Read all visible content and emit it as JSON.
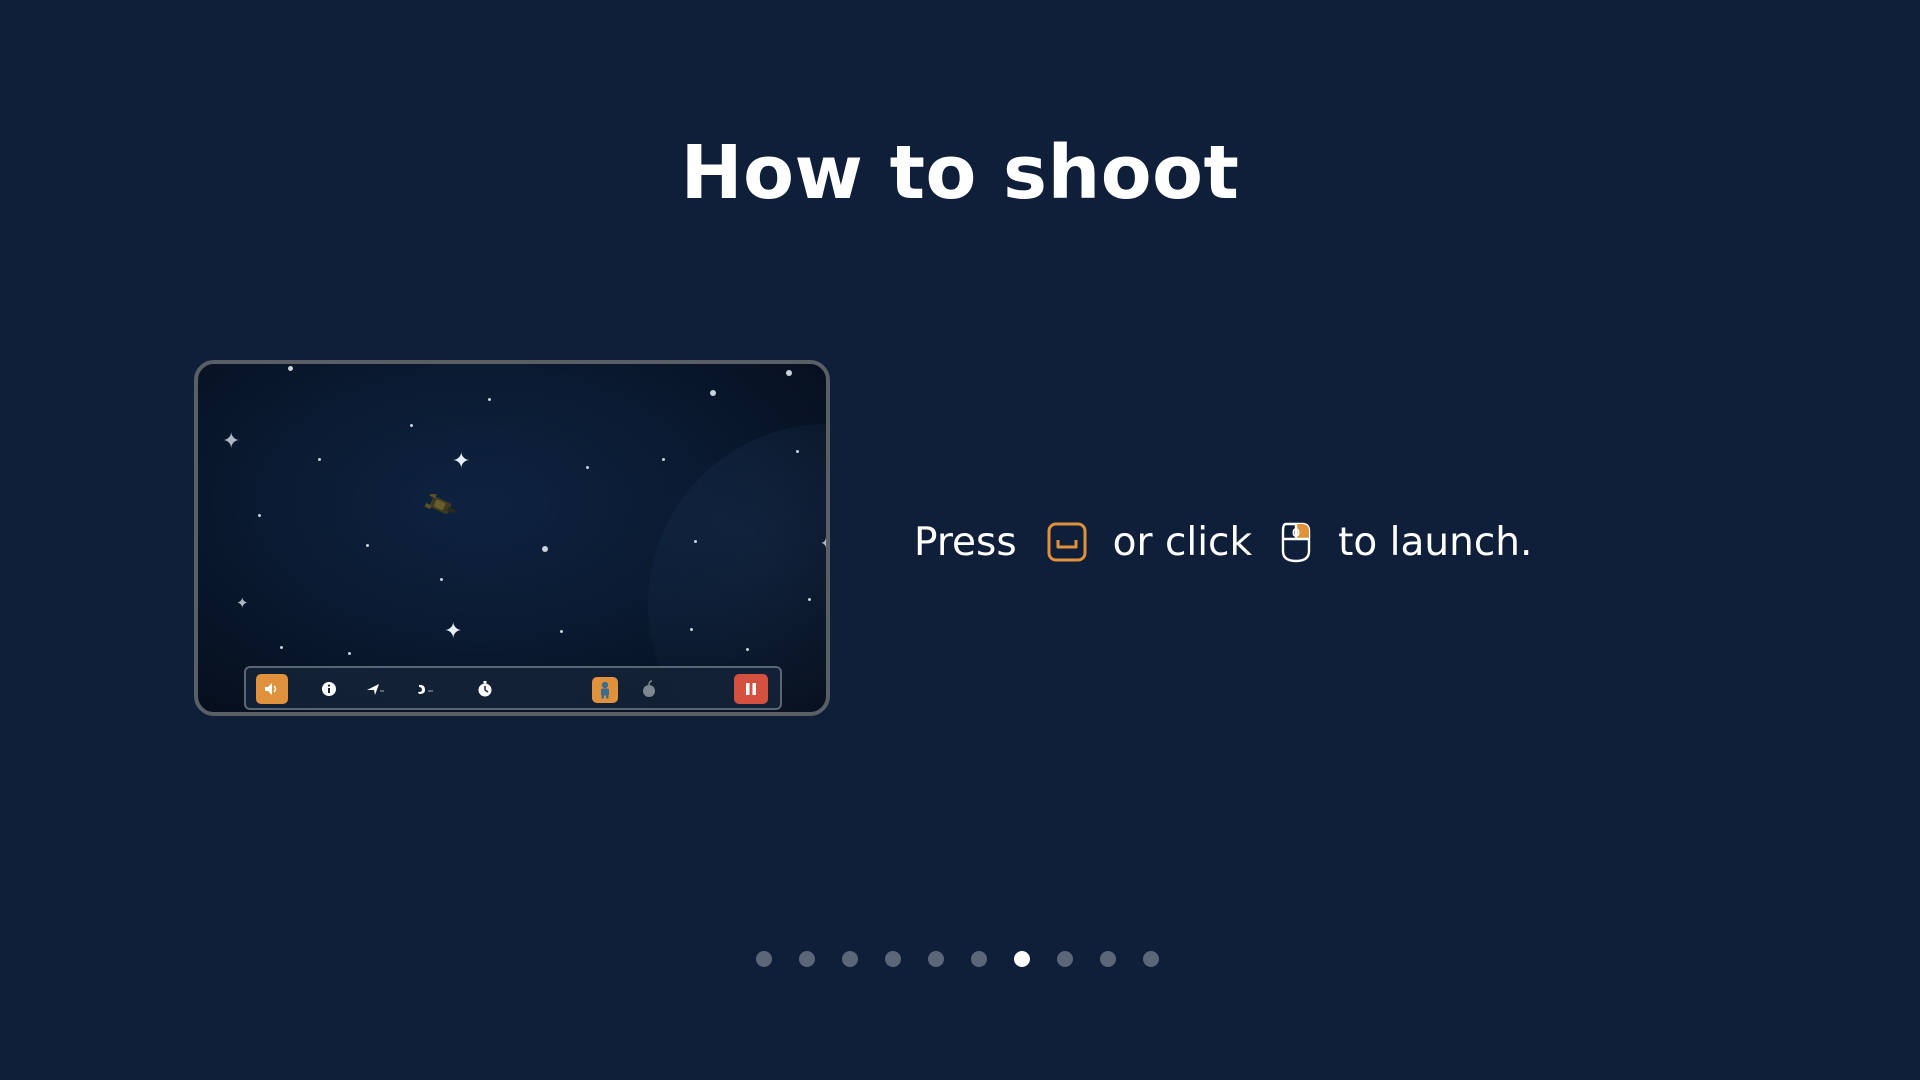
{
  "title": "How to shoot",
  "instruction": {
    "press": "Press",
    "or_click": "or click",
    "to_launch": "to launch.",
    "key_icon": "spacebar-key-icon",
    "mouse_icon": "mouse-left-click-icon"
  },
  "preview": {
    "hud_icons": [
      "sound-icon",
      "info-icon",
      "ship-icon",
      "arm-icon",
      "timer-icon",
      "astronaut-icon",
      "bomb-icon",
      "pause-icon"
    ]
  },
  "pagination": {
    "total": 10,
    "active_index": 6
  },
  "colors": {
    "background": "#0f1f39",
    "accent_orange": "#e0913c",
    "pause_red": "#d4513f",
    "dot_inactive": "#5b6678",
    "dot_active": "#ffffff"
  }
}
